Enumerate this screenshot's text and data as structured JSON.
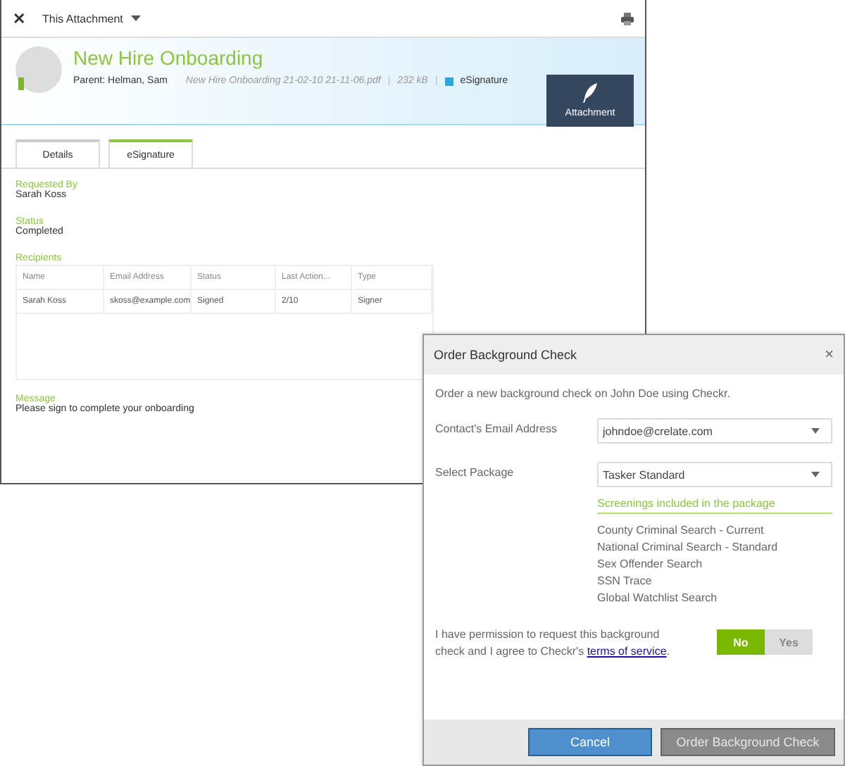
{
  "back_window": {
    "toolbar": {
      "close": "✕",
      "title": "This Attachment"
    },
    "header": {
      "title": "New Hire Onboarding",
      "parent": "Parent: Helman, Sam",
      "file": "New Hire Onboarding 21-02-10 21-11-06.pdf",
      "size": "232 kB",
      "separator": "|",
      "type": "eSignature",
      "button": "Attachment"
    },
    "tabs": [
      {
        "label": "Details",
        "selected": false
      },
      {
        "label": "eSignature",
        "selected": true
      }
    ],
    "fields": [
      {
        "label": "Requested By",
        "value": "Sarah Koss"
      },
      {
        "label": "Status",
        "value": "Completed"
      }
    ],
    "recipients": {
      "label": "Recipients",
      "columns": [
        "Name",
        "Email Address",
        "Status",
        "Last Action...",
        "Type"
      ],
      "rows": [
        [
          "Sarah Koss",
          "skoss@example.com",
          "Signed",
          "2/10",
          "Signer"
        ]
      ]
    },
    "message": {
      "label": "Message",
      "value": "Please sign to complete your onboarding"
    }
  },
  "dialog": {
    "title": "Order Background Check",
    "close": "×",
    "intro": "Order a new background check on John Doe using Checkr.",
    "email": {
      "label": "Contact's Email Address",
      "value": "johndoe@crelate.com"
    },
    "package": {
      "label": "Select Package",
      "value": "Tasker Standard"
    },
    "screenings": {
      "heading": "Screenings included in the package",
      "items": [
        "County Criminal Search - Current",
        "National Criminal Search - Standard",
        "Sex Offender Search",
        "SSN Trace",
        "Global Watchlist Search"
      ]
    },
    "permission": {
      "text": "I have permission to request this background check and I agree to Checkr's",
      "link": "terms of service",
      "end": "."
    },
    "toggle": [
      {
        "label": "No",
        "selected": true
      },
      {
        "label": "Yes",
        "selected": false
      }
    ],
    "buttons": {
      "cancel": "Cancel",
      "order": "Order Background Check"
    }
  }
}
